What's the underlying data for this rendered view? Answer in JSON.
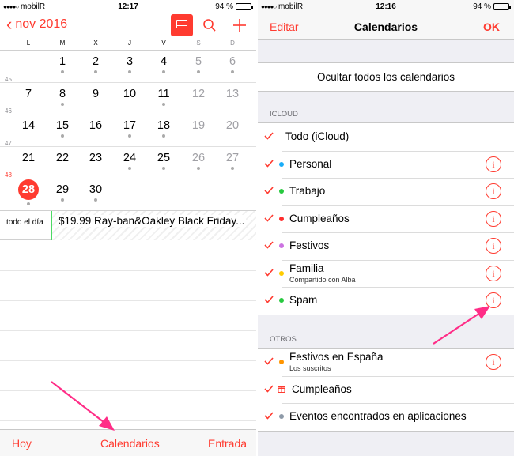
{
  "left": {
    "status": {
      "carrier": "mobilR",
      "time": "12:17",
      "battery": "94 %",
      "battery_level": 0.94
    },
    "nav": {
      "back_label": "nov 2016"
    },
    "weekdays": [
      "L",
      "M",
      "X",
      "J",
      "V",
      "S",
      "D"
    ],
    "weeks": [
      {
        "number": "",
        "days": [
          "",
          "1",
          "2",
          "3",
          "4",
          "5",
          "6"
        ],
        "dots": [
          false,
          true,
          true,
          true,
          true,
          true,
          true
        ]
      },
      {
        "number": "45",
        "days": [
          "7",
          "8",
          "9",
          "10",
          "11",
          "12",
          "13"
        ],
        "dots": [
          false,
          true,
          false,
          false,
          true,
          false,
          false
        ]
      },
      {
        "number": "46",
        "days": [
          "14",
          "15",
          "16",
          "17",
          "18",
          "19",
          "20"
        ],
        "dots": [
          false,
          true,
          false,
          true,
          true,
          false,
          false
        ]
      },
      {
        "number": "47",
        "days": [
          "21",
          "22",
          "23",
          "24",
          "25",
          "26",
          "27"
        ],
        "dots": [
          false,
          false,
          false,
          true,
          true,
          true,
          true
        ]
      },
      {
        "number": "48",
        "days": [
          "28",
          "29",
          "30",
          "",
          "",
          "",
          ""
        ],
        "dots": [
          true,
          true,
          true,
          false,
          false,
          false,
          false
        ]
      }
    ],
    "today": "28",
    "allday_label": "todo el día",
    "event_title": "$19.99 Ray-ban&Oakley Black Friday...",
    "toolbar": {
      "today": "Hoy",
      "calendars": "Calendarios",
      "inbox": "Entrada"
    }
  },
  "right": {
    "status": {
      "carrier": "mobilR",
      "time": "12:16",
      "battery": "94 %",
      "battery_level": 0.94
    },
    "nav": {
      "edit": "Editar",
      "title": "Calendarios",
      "ok": "OK"
    },
    "hide_all": "Ocultar todos los calendarios",
    "icloud_header": "ICLOUD",
    "icloud": [
      {
        "name": "Todo (iCloud)",
        "sub": "",
        "color": "",
        "info": false
      },
      {
        "name": "Personal",
        "sub": "",
        "color": "#1aadf8",
        "info": true
      },
      {
        "name": "Trabajo",
        "sub": "",
        "color": "#27c93f",
        "info": true
      },
      {
        "name": "Cumpleaños",
        "sub": "",
        "color": "#ff2d2d",
        "info": true
      },
      {
        "name": "Festivos",
        "sub": "",
        "color": "#cc73e1",
        "info": true
      },
      {
        "name": "Familia",
        "sub": "Compartido con Alba",
        "color": "#ffcc00",
        "info": true
      },
      {
        "name": "Spam",
        "sub": "",
        "color": "#27c93f",
        "info": true
      }
    ],
    "others_header": "OTROS",
    "others": [
      {
        "name": "Festivos en España",
        "sub": "Los suscritos",
        "color": "#ff9500",
        "info": true,
        "icon": ""
      },
      {
        "name": "Cumpleaños",
        "sub": "",
        "color": "",
        "info": false,
        "icon": "gift-icon"
      },
      {
        "name": "Eventos encontrados en aplicaciones",
        "sub": "",
        "color": "#8e9aa8",
        "info": false,
        "icon": ""
      }
    ],
    "info_glyph": "i"
  },
  "colors": {
    "accent": "#ff3b30",
    "annotation_arrow": "#ff2d87",
    "event_bar": "#4cd964"
  }
}
